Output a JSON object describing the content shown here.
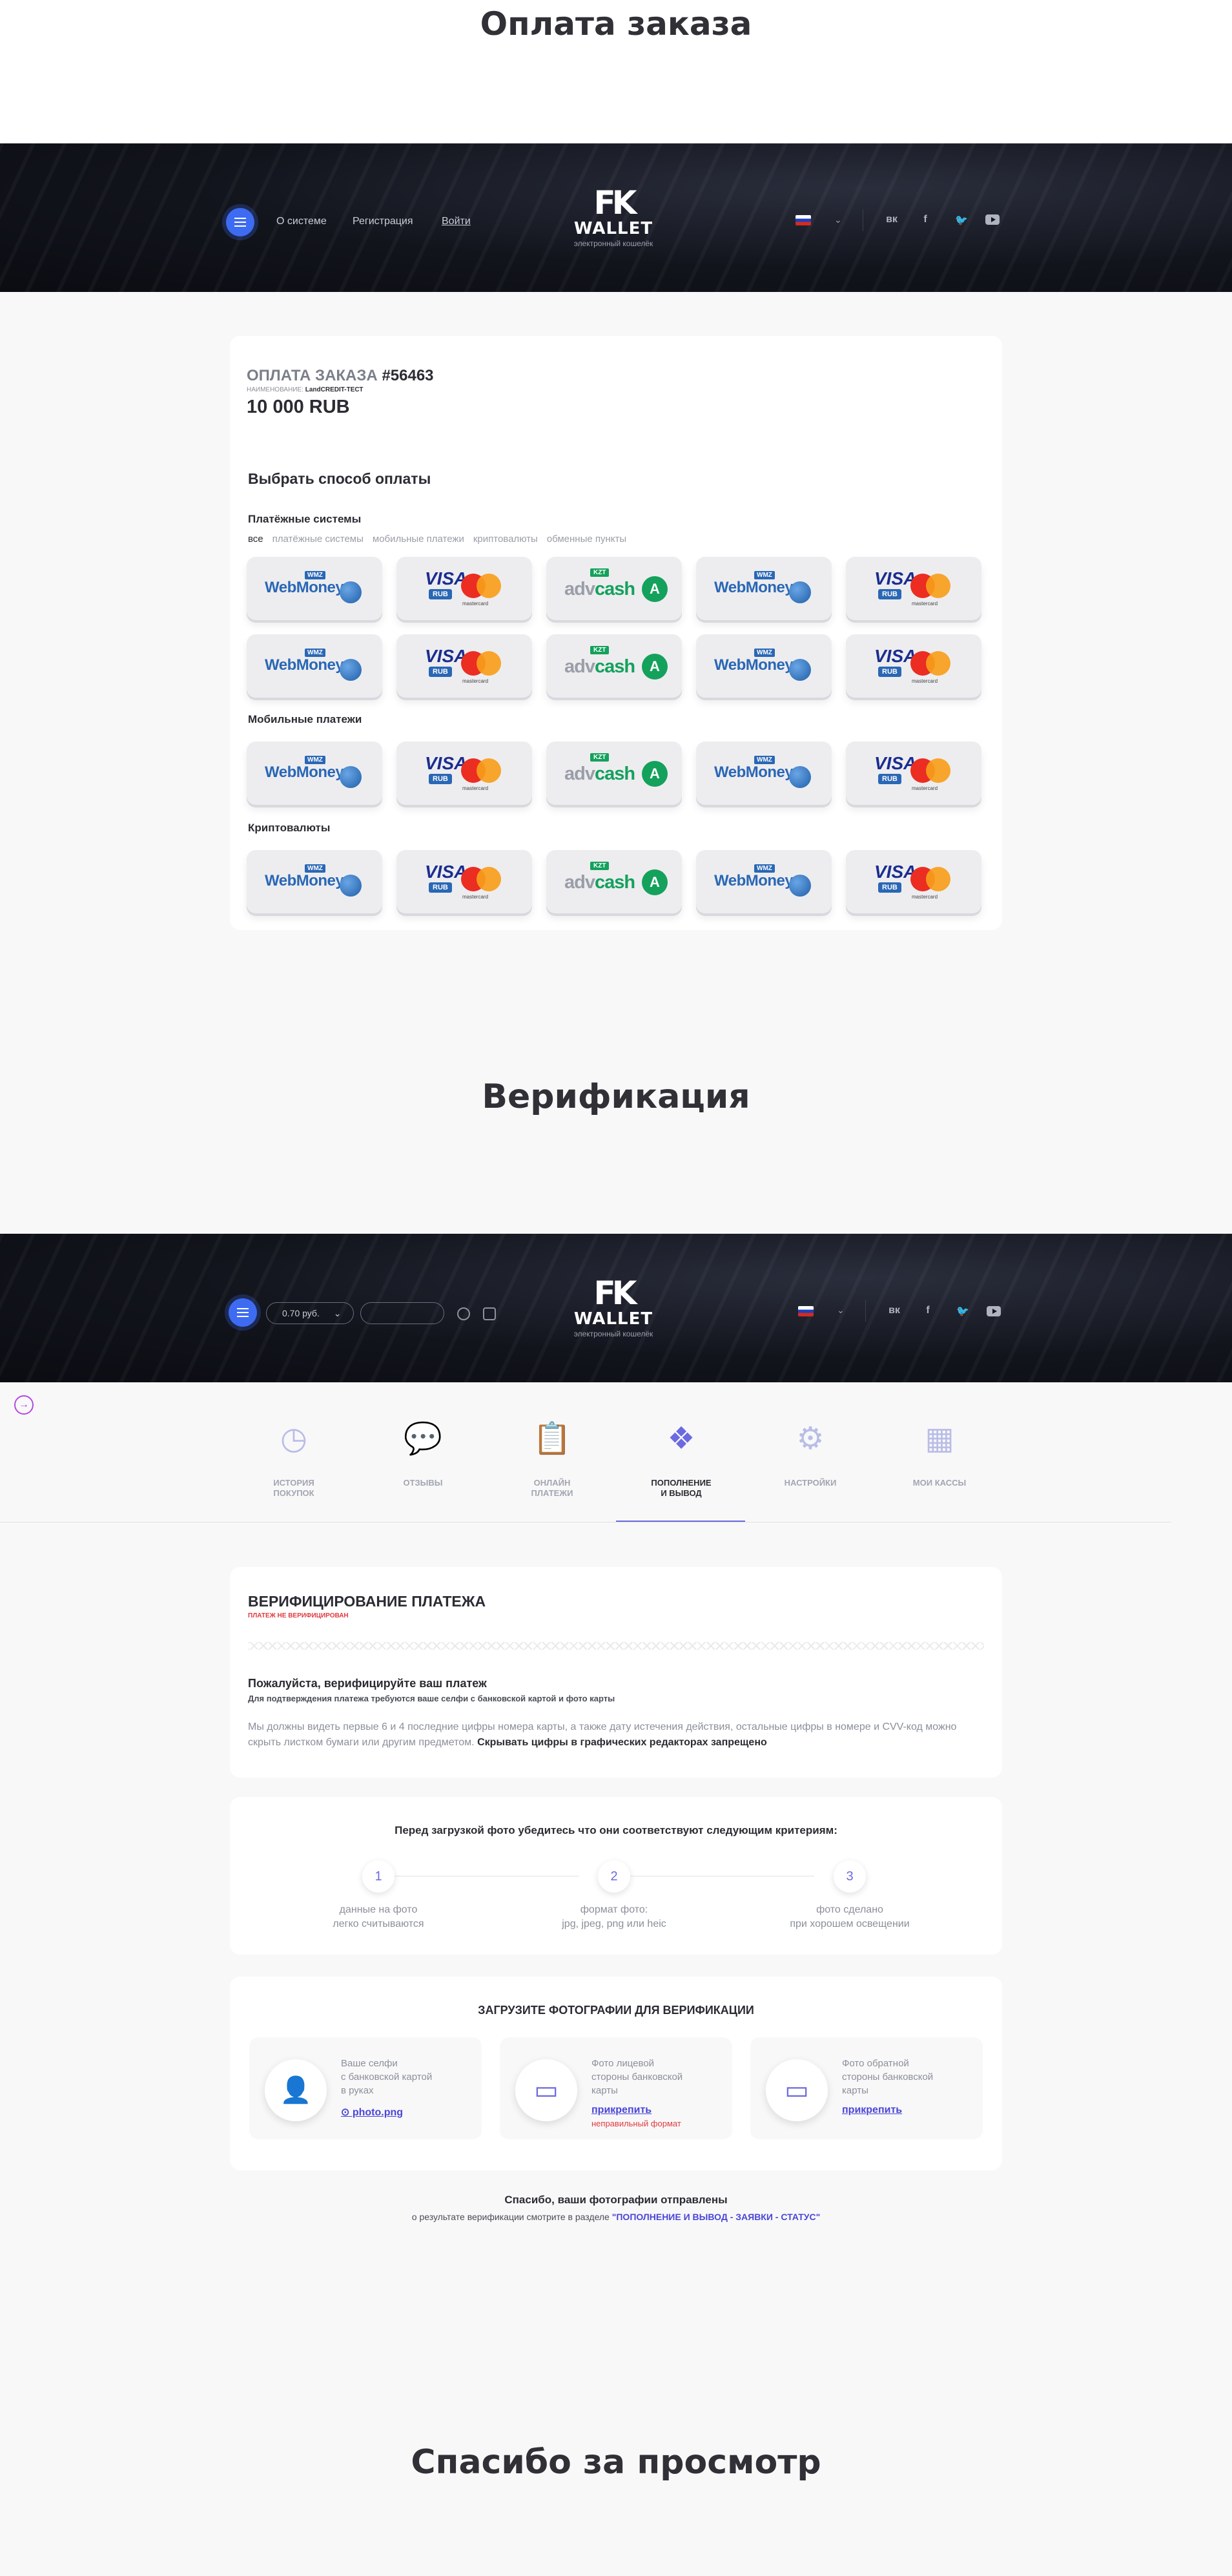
{
  "section1_title": "Оплата заказа",
  "section2_title": "Верификация",
  "section3_title": "Спасибо за просмотр",
  "header1": {
    "nav": [
      "О системе",
      "Регистрация",
      "Войти"
    ],
    "logo": "FK",
    "logo_word": "WALLET",
    "logo_sub": "электронный кошелёк",
    "social": [
      "вк",
      "f"
    ]
  },
  "order": {
    "title_prefix": "ОПЛАТА ЗАКАЗА",
    "order_no": "#56463",
    "name_label": "НАИМЕНОВАНИЕ:",
    "name_value": "LandCREDIT-ТЕСТ",
    "amount": "10 000 RUB",
    "choose_title": "Выбрать способ оплаты",
    "group1": "Платёжные системы",
    "filters": [
      "все",
      "платёжные системы",
      "мобильные платежи",
      "криптовалюты",
      "обменные пункты"
    ],
    "group2": "Мобильные платежи",
    "group3": "Криптовалюты",
    "wm": "WebMoney",
    "wmz": "WMZ",
    "visa": "VISA",
    "rub": "RUB",
    "mastercard": "mastercard",
    "adv": "adv",
    "cash": "cash",
    "kzt": "KZT",
    "adv_icon": "A"
  },
  "header2": {
    "balance": "0.70 руб.",
    "logo": "FK",
    "logo_word": "WALLET",
    "logo_sub": "электронный кошелёк",
    "social": [
      "вк",
      "f"
    ]
  },
  "tabs": [
    {
      "line1": "ИСТОРИЯ",
      "line2": "ПОКУПОК",
      "icon": "clock-icon"
    },
    {
      "line1": "ОТЗЫВЫ",
      "line2": "",
      "icon": "chat-icon"
    },
    {
      "line1": "ОНЛАЙН",
      "line2": "ПЛАТЕЖИ",
      "icon": "clipboard-icon"
    },
    {
      "line1": "ПОПОЛНЕНИЕ",
      "line2": "И ВЫВОД",
      "icon": "exchange-icon"
    },
    {
      "line1": "НАСТРОЙКИ",
      "line2": "",
      "icon": "gear-icon"
    },
    {
      "line1": "МОИ КАССЫ",
      "line2": "",
      "icon": "calculator-icon"
    }
  ],
  "verify": {
    "title": "ВЕРИФИЦИРОВАНИЕ ПЛАТЕЖА",
    "status": "ПЛАТЕЖ НЕ ВЕРИФИЦИРОВАН",
    "heading": "Пожалуйста, верифицируйте ваш платеж",
    "subheading": "Для подтверждения платежа требуются ваше селфи с банковской картой и фото карты",
    "text": "Мы должны видеть первые 6 и 4 последние цифры номера карты, а также дату истечения действия, остальные цифры в номере и CVV-код можно скрыть листком бумаги или другим предметом.",
    "text_bold": "Скрывать цифры в графических редакторах запрещено"
  },
  "criteria": {
    "title": "Перед загрузкой фото убедитесь что они соответствуют следующим критериям:",
    "steps": [
      {
        "n": "1",
        "l1": "данные на фото",
        "l2": "легко считываются"
      },
      {
        "n": "2",
        "l1": "формат фото:",
        "l2": "jpg, jpeg, png или heic"
      },
      {
        "n": "3",
        "l1": "фото сделано",
        "l2": "при хорошем освещении"
      }
    ]
  },
  "upload": {
    "title": "ЗАГРУЗИТЕ ФОТОГРАФИИ ДЛЯ ВЕРИФИКАЦИИ",
    "items": [
      {
        "l1": "Ваше селфи",
        "l2": "с банковской картой",
        "l3": "в руках",
        "link": "⊙ photo.png",
        "err": ""
      },
      {
        "l1": "Фото лицевой",
        "l2": "стороны банковской",
        "l3": "карты",
        "link": "прикрепить",
        "err": "неправильный формат"
      },
      {
        "l1": "Фото обратной",
        "l2": "стороны банковской",
        "l3": "карты",
        "link": "прикрепить",
        "err": ""
      }
    ]
  },
  "thanks": {
    "title": "Спасибо, ваши фотографии отправлены",
    "text": "о результате верификации смотрите в разделе",
    "link": "\"ПОПОЛНЕНИЕ И ВЫВОД - ЗАЯВКИ - СТАТУС\""
  }
}
